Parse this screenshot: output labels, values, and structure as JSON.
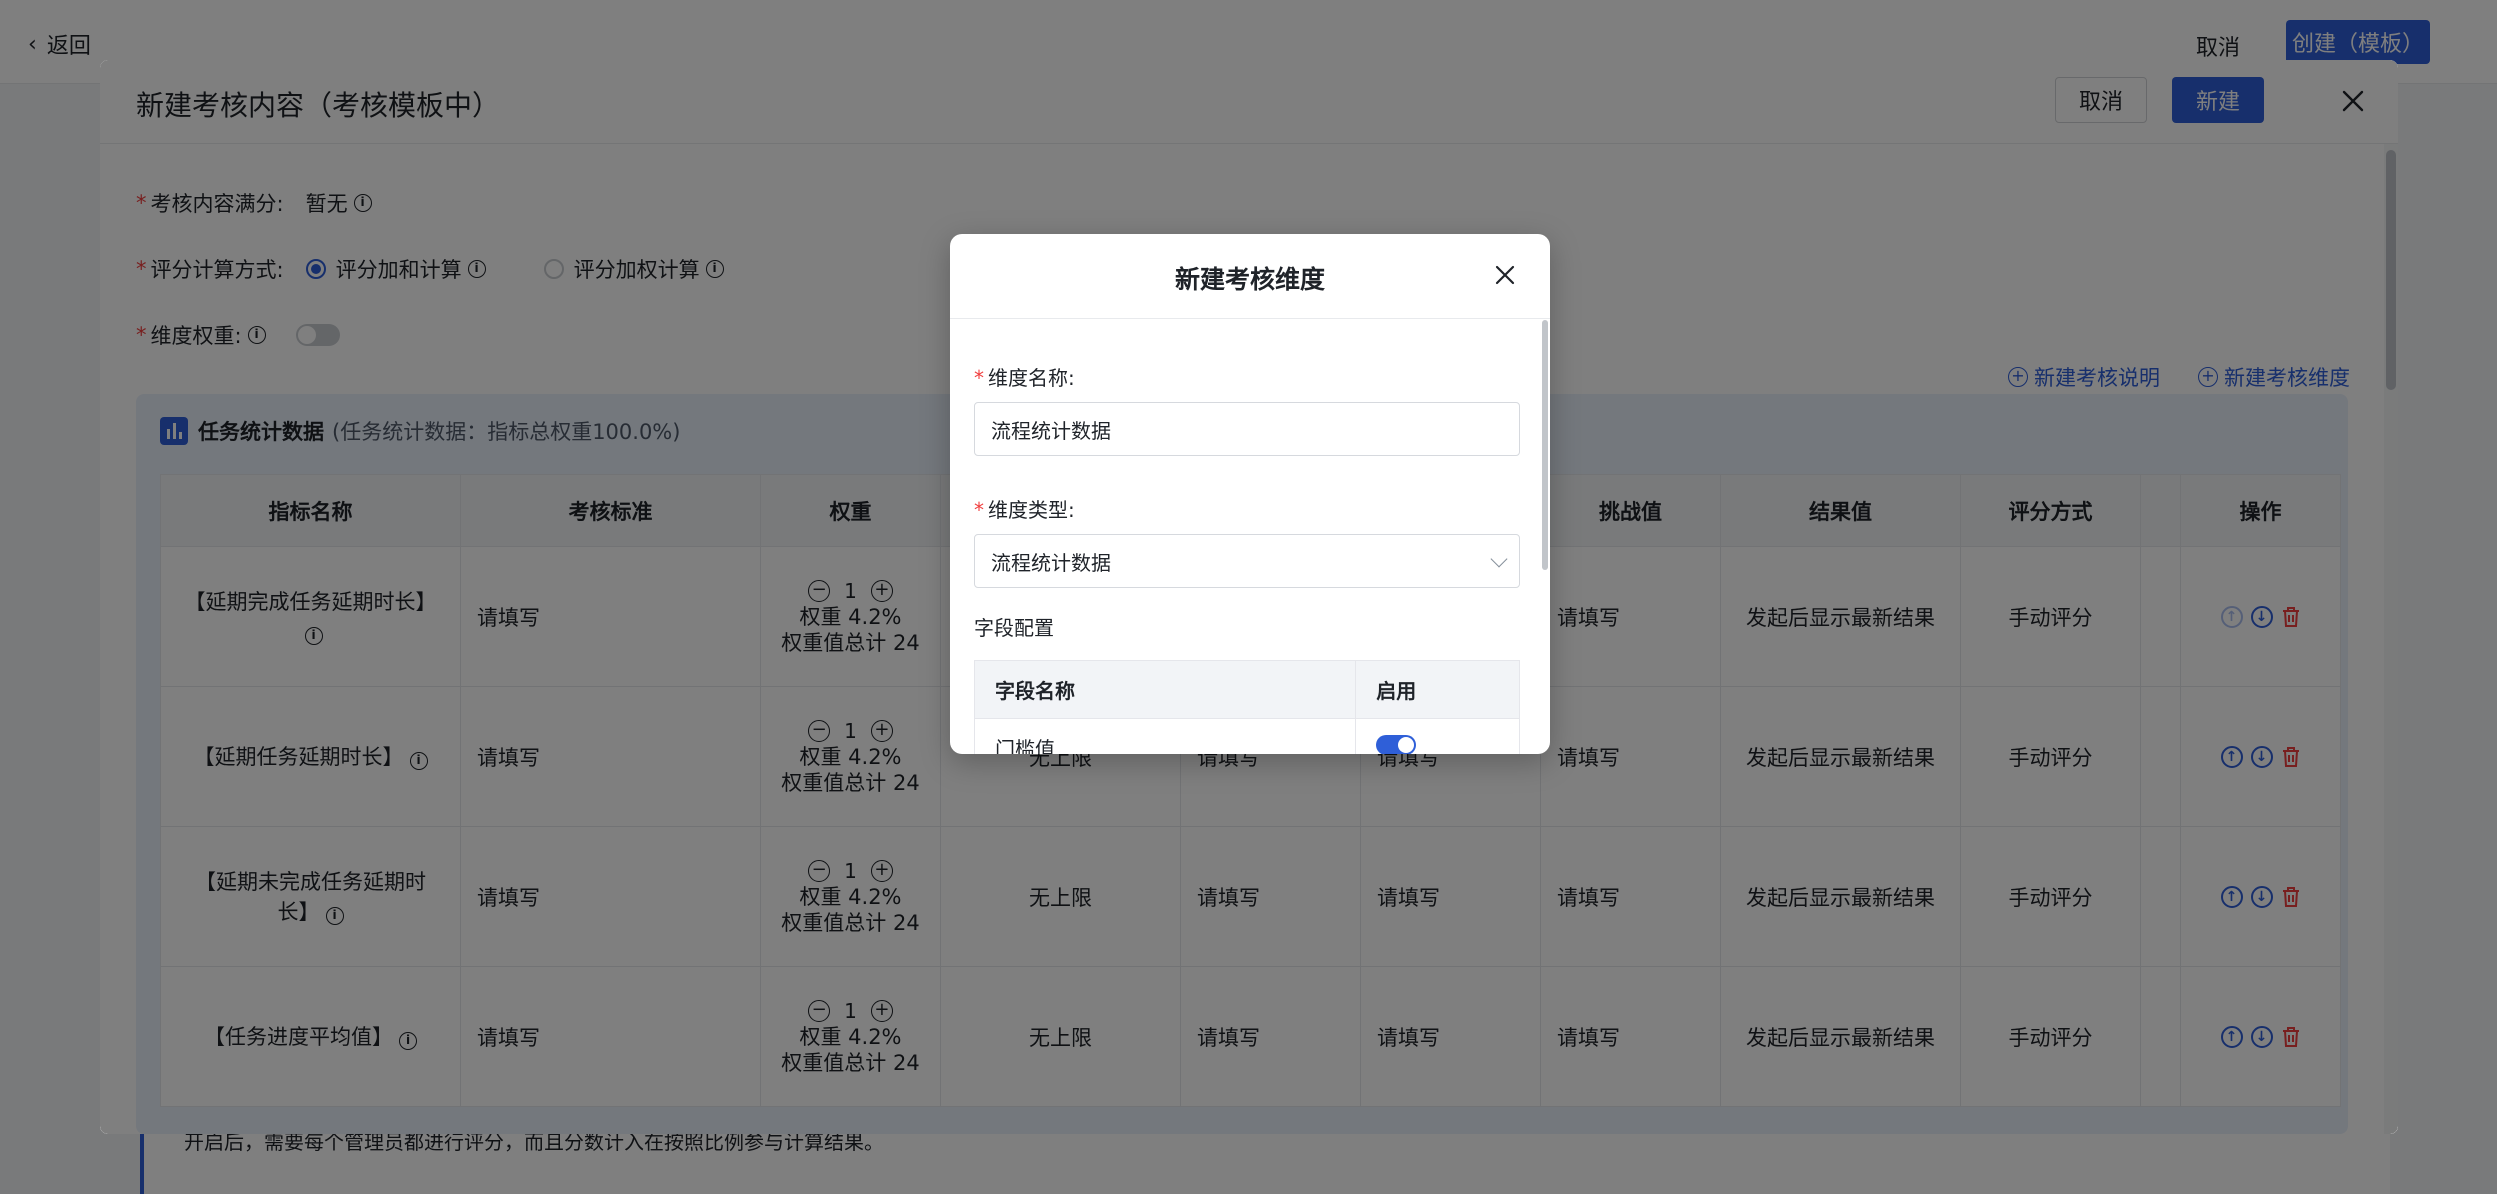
{
  "base": {
    "back_label": "返回",
    "cancel_label": "取消",
    "create_label": "创建（模板）",
    "strip_text": "开启后，需要每个管理员都进行评分，而且分数计入在按照比例参与计算结果。"
  },
  "modal": {
    "title": "新建考核内容（考核模板中）",
    "cancel_label": "取消",
    "new_label": "新建",
    "full_score_label": "考核内容满分:",
    "full_score_value": "暂无",
    "calc_label": "评分计算方式:",
    "calc_options": [
      "评分加和计算",
      "评分加权计算"
    ],
    "weight_label": "维度权重:",
    "links": [
      "新建考核说明",
      "新建考核维度"
    ],
    "panel": {
      "title": "任务统计数据",
      "subtitle": "(任务统计数据：指标总权重100.0%)",
      "columns": [
        "指标名称",
        "考核标准",
        "权重",
        "",
        "",
        "",
        "挑战值",
        "结果值",
        "评分方式",
        "",
        "操作"
      ],
      "rows": [
        {
          "name": "【延期完成任务延期时长】",
          "standard": "请填写",
          "weight": "1",
          "weight_pct": "权重 4.2%",
          "weight_total": "权重值总计 24",
          "limit": "",
          "c5": "",
          "c6": "",
          "challenge": "请填写",
          "result": "发起后显示最新结果",
          "mode": "手动评分"
        },
        {
          "name": "【延期任务延期时长】",
          "standard": "请填写",
          "weight": "1",
          "weight_pct": "权重 4.2%",
          "weight_total": "权重值总计 24",
          "limit": "无上限",
          "c5": "请填写",
          "c6": "请填写",
          "challenge": "请填写",
          "result": "发起后显示最新结果",
          "mode": "手动评分"
        },
        {
          "name": "【延期未完成任务延期时长】",
          "standard": "请填写",
          "weight": "1",
          "weight_pct": "权重 4.2%",
          "weight_total": "权重值总计 24",
          "limit": "无上限",
          "c5": "请填写",
          "c6": "请填写",
          "challenge": "请填写",
          "result": "发起后显示最新结果",
          "mode": "手动评分"
        },
        {
          "name": "【任务进度平均值】",
          "standard": "请填写",
          "weight": "1",
          "weight_pct": "权重 4.2%",
          "weight_total": "权重值总计 24",
          "limit": "无上限",
          "c5": "请填写",
          "c6": "请填写",
          "challenge": "请填写",
          "result": "发起后显示最新结果",
          "mode": "手动评分"
        }
      ]
    }
  },
  "dialog": {
    "title": "新建考核维度",
    "name_label": "维度名称:",
    "name_value": "流程统计数据",
    "type_label": "维度类型:",
    "type_value": "流程统计数据",
    "fields_label": "字段配置",
    "field_table": {
      "headers": [
        "字段名称",
        "启用"
      ],
      "rows": [
        {
          "name": "门槛值"
        }
      ]
    }
  },
  "colors": {
    "primary": "#2f5fd8",
    "danger": "#f03e3e",
    "overlay": "rgba(0,0,0,0.5)"
  }
}
